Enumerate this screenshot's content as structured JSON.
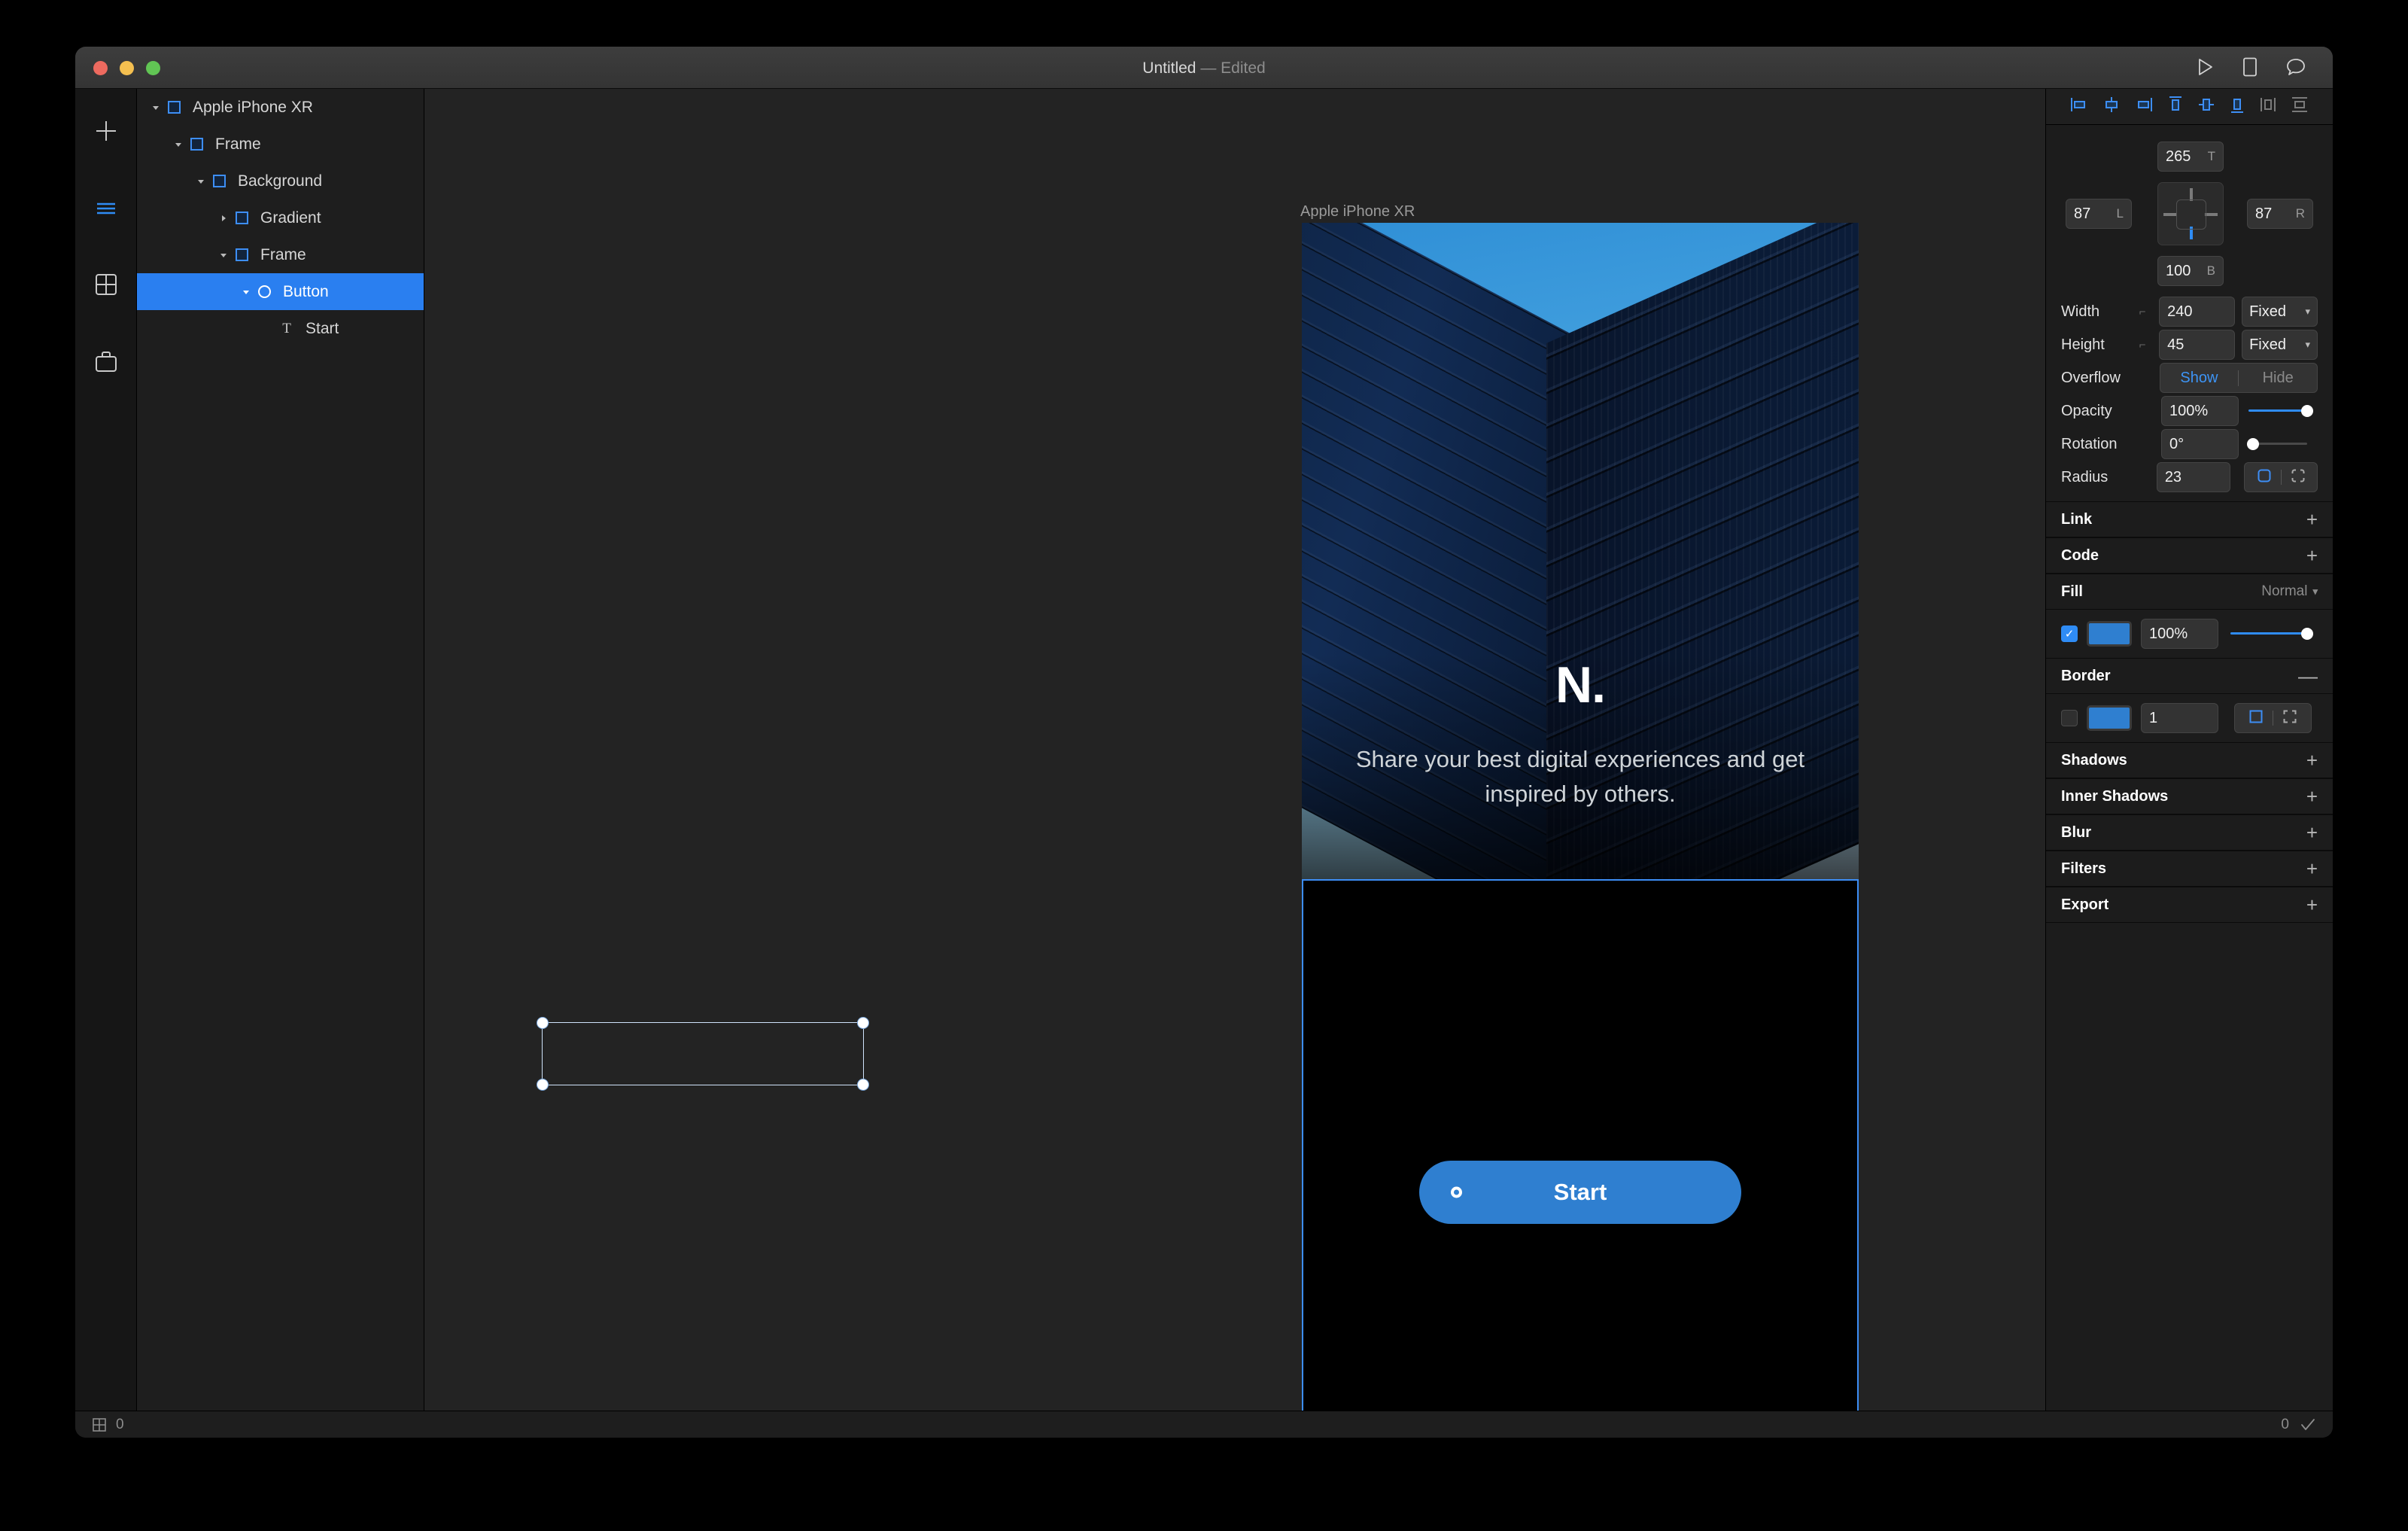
{
  "window": {
    "title": "Untitled",
    "title_suffix": "— Edited",
    "traffic": [
      "close-button",
      "minimize-button",
      "zoom-button"
    ],
    "toolbar_icons": [
      "preview-play-icon",
      "device-icon",
      "comment-icon"
    ]
  },
  "rail": {
    "items": [
      {
        "name": "add-icon",
        "label": "+"
      },
      {
        "name": "layers-icon",
        "label": ""
      },
      {
        "name": "components-icon",
        "label": ""
      },
      {
        "name": "assets-icon",
        "label": ""
      }
    ]
  },
  "layers": {
    "items": [
      {
        "name": "Apple iPhone XR",
        "depth": 0,
        "icon": "frame-icon",
        "disclosure": "open",
        "selected": false
      },
      {
        "name": "Frame",
        "depth": 1,
        "icon": "frame-icon",
        "disclosure": "open",
        "selected": false
      },
      {
        "name": "Background",
        "depth": 2,
        "icon": "frame-icon",
        "disclosure": "open",
        "selected": false
      },
      {
        "name": "Gradient",
        "depth": 3,
        "icon": "frame-icon",
        "disclosure": "closed",
        "selected": false
      },
      {
        "name": "Frame",
        "depth": 3,
        "icon": "frame-icon",
        "disclosure": "open",
        "selected": false
      },
      {
        "name": "Button",
        "depth": 4,
        "icon": "circle-icon",
        "disclosure": "open",
        "selected": true
      },
      {
        "name": "Start",
        "depth": 5,
        "icon": "text-icon",
        "disclosure": "none",
        "selected": false
      }
    ]
  },
  "canvas": {
    "artboard_label": "Apple iPhone XR",
    "logo": "N.",
    "tagline": "Share your best digital experiences and get inspired by others.",
    "button_label": "Start"
  },
  "inspector": {
    "align_icons": [
      "align-left-icon",
      "align-center-horizontal-icon",
      "align-right-icon",
      "align-top-icon",
      "align-center-vertical-icon",
      "align-bottom-icon",
      "distribute-horizontal-icon",
      "distribute-vertical-icon"
    ],
    "constraints": {
      "top": "265",
      "top_suffix": "T",
      "left": "87",
      "left_suffix": "L",
      "right": "87",
      "right_suffix": "R",
      "bottom": "100",
      "bottom_suffix": "B"
    },
    "width": {
      "label": "Width",
      "value": "240",
      "mode": "Fixed"
    },
    "height": {
      "label": "Height",
      "value": "45",
      "mode": "Fixed"
    },
    "overflow": {
      "label": "Overflow",
      "show": "Show",
      "hide": "Hide",
      "selected": "Show"
    },
    "opacity": {
      "label": "Opacity",
      "value": "100%"
    },
    "rotation": {
      "label": "Rotation",
      "value": "0°"
    },
    "radius": {
      "label": "Radius",
      "value": "23"
    },
    "sections": [
      {
        "label": "Link",
        "action": "+"
      },
      {
        "label": "Code",
        "action": "+"
      },
      {
        "label": "Shadows",
        "action": "+"
      },
      {
        "label": "Inner Shadows",
        "action": "+"
      },
      {
        "label": "Blur",
        "action": "+"
      },
      {
        "label": "Filters",
        "action": "+"
      },
      {
        "label": "Export",
        "action": "+"
      }
    ],
    "fill": {
      "label": "Fill",
      "blend_mode": "Normal",
      "enabled": true,
      "color": "#2f7fd0",
      "opacity": "100%"
    },
    "border": {
      "label": "Border",
      "action": "—",
      "enabled": false,
      "color": "#2f7fd0",
      "width": "1"
    }
  },
  "status": {
    "left_count": "0",
    "right_count": "0",
    "check": "✓"
  }
}
